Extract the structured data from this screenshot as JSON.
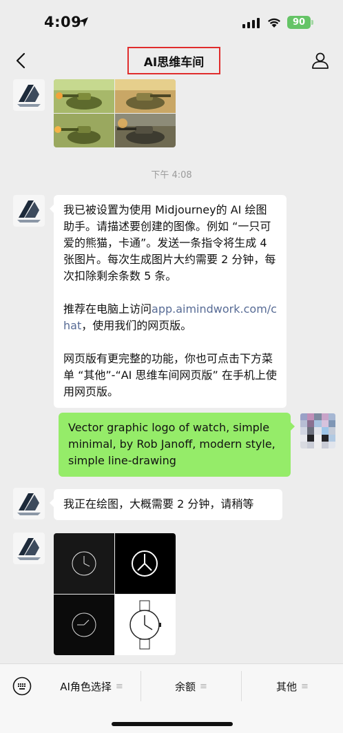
{
  "status_bar": {
    "time": "4:09",
    "battery": "90"
  },
  "nav": {
    "title": "AI思维车间"
  },
  "messages": {
    "timestamp": "下午 4:08",
    "intro_part1": "我已被设置为使用 Midjourney的 AI 绘图助手。请描述要创建的图像。例如 “一只可爱的熊猫，卡通”。发送一条指令将生成 4 张图片。每次生成图片大约需要 2 分钟，每次扣除剩余条数 5 条。\n\n推荐在电脑上访问",
    "intro_link": "app.aimindwork.com/chat",
    "intro_part2": "，使用我们的网页版。\n\n网页版有更完整的功能，你也可点击下方菜单 “其他”-“AI 思维车间网页版” 在手机上使用网页版。",
    "user_prompt": "Vector graphic logo of watch, simple minimal, by Rob Janoff, modern style, simple line-drawing",
    "drawing_status": "我正在绘图，大概需要 2 分钟，请稍等"
  },
  "bottom_menu": {
    "item1": "AI角色选择",
    "item2": "余额",
    "item3": "其他"
  },
  "icons": {
    "back": "chevron-left-icon",
    "profile": "person-icon",
    "keyboard": "keyboard-icon",
    "menu": "menu-lines-icon"
  },
  "colors": {
    "background": "#ededed",
    "user_bubble": "#95ec69",
    "bot_bubble": "#ffffff",
    "link": "#576b95",
    "title_highlight": "#e02b2b"
  }
}
